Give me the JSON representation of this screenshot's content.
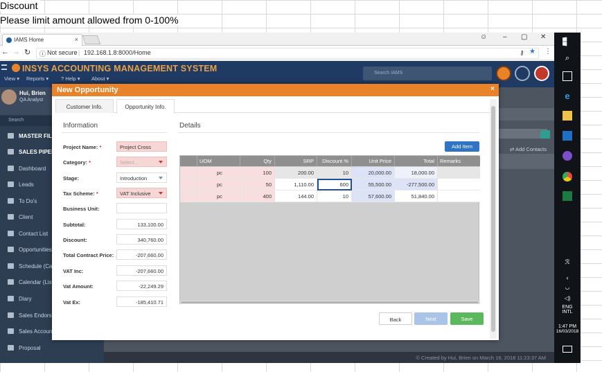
{
  "excel": {
    "row1": "Discount",
    "row2": "Please limit amount allowed from 0-100%"
  },
  "browser": {
    "tab_title": "IAMS Home",
    "tab_close": "×",
    "security": "Not secure",
    "url": "192.168.1.8:8000/Home",
    "controls": {
      "minimize": "–",
      "maximize": "▢",
      "close": "✕"
    }
  },
  "app": {
    "brand": "INSYS ACCOUNTING MANAGEMENT SYSTEM",
    "menu": [
      "View ▾",
      "Reports ▾",
      "? Help ▾",
      "About ▾"
    ],
    "search_placeholder": "Search IAMS",
    "user": {
      "name": "Hui, Brien",
      "role": "QA Analyst"
    },
    "sidebar_search": "Search",
    "nav": [
      "MASTER FILE",
      "SALES PIPELINE",
      "Dashboard",
      "Leads",
      "To Do's",
      "Client",
      "Contact List",
      "Opportunities",
      "Schedule (Ca",
      "Calendar (List",
      "Diary",
      "Sales Endorse",
      "Sales Accoun",
      "Proposal"
    ],
    "add_contacts": "Add Contacts",
    "footer": "© Created by Hui, Brien on March 16, 2018 11:23:37 AM"
  },
  "modal": {
    "title": "New Opportunity",
    "close": "×",
    "tabs": [
      "Customer Info.",
      "Opportunity Info."
    ],
    "info_title": "Information",
    "details_title": "Details",
    "fields": [
      {
        "label": "Project Name:",
        "required": "*",
        "value": "Project Cross"
      },
      {
        "label": "Category:",
        "required": "*",
        "value": "Select..."
      },
      {
        "label": "Stage:",
        "required": "",
        "value": "Introduction"
      },
      {
        "label": "Tax Scheme:",
        "required": "*",
        "value": "VAT Inclusive"
      },
      {
        "label": "Business Unit:",
        "required": "",
        "value": ""
      },
      {
        "label": "Subtotal:",
        "required": "",
        "value": "133,100.00"
      },
      {
        "label": "Discount:",
        "required": "",
        "value": "340,760.00"
      },
      {
        "label": "Total Contract Price:",
        "required": "",
        "value": "-207,660.00"
      },
      {
        "label": "VAT Inc:",
        "required": "",
        "value": "-207,660.00"
      },
      {
        "label": "Vat Amount:",
        "required": "",
        "value": "-22,249.29"
      },
      {
        "label": "Vat Ex:",
        "required": "",
        "value": "-185,410.71"
      }
    ],
    "add_item": "Add Item",
    "grid_headers": [
      "UOM",
      "Qty",
      "SRP",
      "Discount %",
      "Unit Price",
      "Total",
      "Remarks"
    ],
    "grid_rows": [
      [
        "pc",
        "100",
        "200.00",
        "10",
        "20,000.00",
        "18,000.00",
        ""
      ],
      [
        "pc",
        "50",
        "1,110.00",
        "600",
        "55,500.00",
        "-277,500.00",
        ""
      ],
      [
        "pc",
        "400",
        "144.00",
        "10",
        "57,600.00",
        "51,840.00",
        ""
      ]
    ],
    "buttons": {
      "back": "Back",
      "next": "Next",
      "save": "Save"
    }
  },
  "taskbar": {
    "lang1": "ENG",
    "lang2": "INTL",
    "time": "1:47 PM",
    "date": "16/03/2018"
  },
  "colors": {
    "header": "#1f3a63",
    "brand": "#e9a14a",
    "modal_header": "#e8832a",
    "primary_button": "#2f75c4",
    "save_button": "#5cb85c",
    "selected_cell_border": "#1d4f9a"
  }
}
